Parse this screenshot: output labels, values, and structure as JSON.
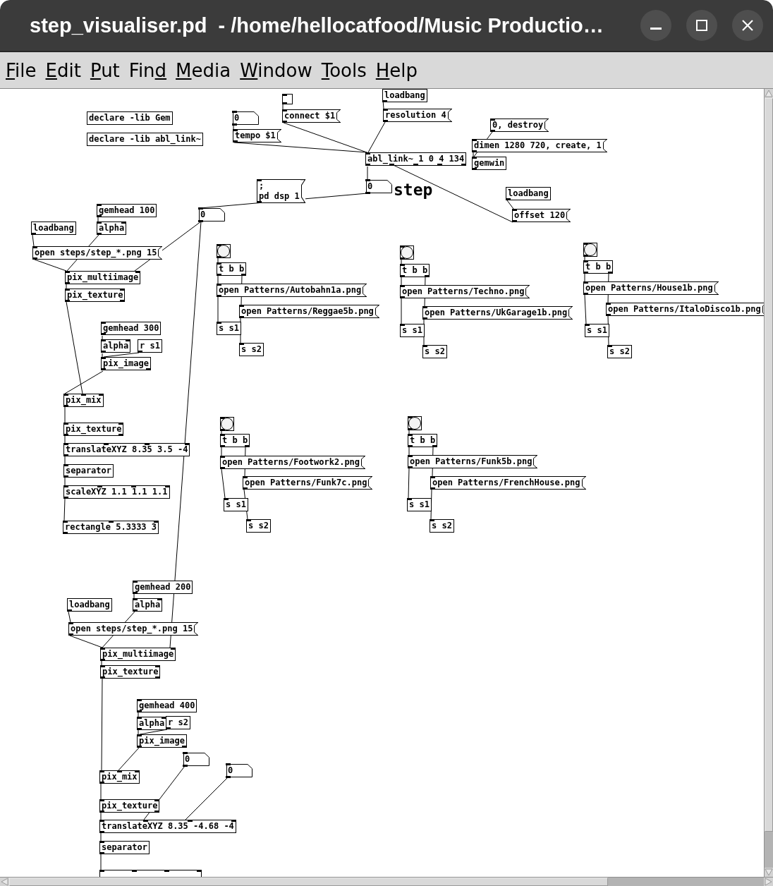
{
  "window": {
    "title": "step_visualiser.pd  - /home/hellocatfood/Music Productio…"
  },
  "menu": [
    {
      "parts": [
        {
          "text": "F",
          "underlined": true
        },
        {
          "text": "ile",
          "underlined": false
        }
      ]
    },
    {
      "parts": [
        {
          "text": "E",
          "underlined": true
        },
        {
          "text": "dit",
          "underlined": false
        }
      ]
    },
    {
      "parts": [
        {
          "text": "P",
          "underlined": true
        },
        {
          "text": "ut",
          "underlined": false
        }
      ]
    },
    {
      "parts": [
        {
          "text": "Fin",
          "underlined": false
        },
        {
          "text": "d",
          "underlined": true
        }
      ]
    },
    {
      "parts": [
        {
          "text": "M",
          "underlined": true
        },
        {
          "text": "edia",
          "underlined": false
        }
      ]
    },
    {
      "parts": [
        {
          "text": "W",
          "underlined": true
        },
        {
          "text": "indow",
          "underlined": false
        }
      ]
    },
    {
      "parts": [
        {
          "text": "T",
          "underlined": true
        },
        {
          "text": "ools",
          "underlined": false
        }
      ]
    },
    {
      "parts": [
        {
          "text": "H",
          "underlined": true
        },
        {
          "text": "elp",
          "underlined": false
        }
      ]
    }
  ],
  "canvas": {
    "items": [
      {
        "kind": "object",
        "text": "declare -lib Gem"
      },
      {
        "kind": "object",
        "text": "declare -lib abl_link~"
      },
      {
        "kind": "toggle",
        "checked": false
      },
      {
        "kind": "number",
        "text": "0"
      },
      {
        "kind": "message",
        "text": "connect $1"
      },
      {
        "kind": "message",
        "text": "tempo $1"
      },
      {
        "kind": "object",
        "text": "loadbang"
      },
      {
        "kind": "message",
        "text": "resolution 4"
      },
      {
        "kind": "message",
        "text": "0, destroy"
      },
      {
        "kind": "message",
        "text": "dimen 1280 720, create, 1"
      },
      {
        "kind": "object",
        "text": "abl_link~ 1 0 4 134"
      },
      {
        "kind": "object",
        "text": "gemwin"
      },
      {
        "kind": "message",
        "text": ";\npd dsp 1"
      },
      {
        "kind": "number",
        "text": "0"
      },
      {
        "kind": "comment",
        "text": "step"
      },
      {
        "kind": "object",
        "text": "loadbang"
      },
      {
        "kind": "object",
        "text": "gemhead 100"
      },
      {
        "kind": "number",
        "text": "0"
      },
      {
        "kind": "message",
        "text": "offset 120"
      },
      {
        "kind": "object",
        "text": "loadbang"
      },
      {
        "kind": "object",
        "text": "alpha"
      },
      {
        "kind": "message",
        "text": "open steps/step_*.png 15"
      },
      {
        "kind": "object",
        "text": "pix_multiimage"
      },
      {
        "kind": "object",
        "text": "pix_texture"
      },
      {
        "kind": "object",
        "text": "gemhead 300"
      },
      {
        "kind": "object",
        "text": "alpha"
      },
      {
        "kind": "object",
        "text": "r s1"
      },
      {
        "kind": "object",
        "text": "pix_image"
      },
      {
        "kind": "object",
        "text": "pix_mix"
      },
      {
        "kind": "object",
        "text": "pix_texture"
      },
      {
        "kind": "object",
        "text": "translateXYZ 8.35 3.5 -4"
      },
      {
        "kind": "object",
        "text": "separator"
      },
      {
        "kind": "object",
        "text": "scaleXYZ 1.1 1.1 1.1"
      },
      {
        "kind": "object",
        "text": "rectangle 5.3333 3"
      },
      {
        "kind": "bang"
      },
      {
        "kind": "object",
        "text": "t b b"
      },
      {
        "kind": "message",
        "text": "open Patterns/Autobahn1a.png"
      },
      {
        "kind": "message",
        "text": "open Patterns/Reggae5b.png"
      },
      {
        "kind": "object",
        "text": "s s1"
      },
      {
        "kind": "object",
        "text": "s s2"
      },
      {
        "kind": "bang"
      },
      {
        "kind": "object",
        "text": "t b b"
      },
      {
        "kind": "message",
        "text": "open Patterns/Techno.png"
      },
      {
        "kind": "message",
        "text": "open Patterns/UkGarage1b.png"
      },
      {
        "kind": "object",
        "text": "s s1"
      },
      {
        "kind": "object",
        "text": "s s2"
      },
      {
        "kind": "bang"
      },
      {
        "kind": "object",
        "text": "t b b"
      },
      {
        "kind": "message",
        "text": "open Patterns/House1b.png"
      },
      {
        "kind": "message",
        "text": "open Patterns/ItaloDisco1b.png"
      },
      {
        "kind": "object",
        "text": "s s1"
      },
      {
        "kind": "object",
        "text": "s s2"
      },
      {
        "kind": "bang"
      },
      {
        "kind": "object",
        "text": "t b b"
      },
      {
        "kind": "message",
        "text": "open Patterns/Footwork2.png"
      },
      {
        "kind": "message",
        "text": "open Patterns/Funk7c.png"
      },
      {
        "kind": "object",
        "text": "s s1"
      },
      {
        "kind": "object",
        "text": "s s2"
      },
      {
        "kind": "bang"
      },
      {
        "kind": "object",
        "text": "t b b"
      },
      {
        "kind": "message",
        "text": "open Patterns/Funk5b.png"
      },
      {
        "kind": "message",
        "text": "open Patterns/FrenchHouse.png"
      },
      {
        "kind": "object",
        "text": "s s1"
      },
      {
        "kind": "object",
        "text": "s s2"
      },
      {
        "kind": "object",
        "text": "gemhead 200"
      },
      {
        "kind": "object",
        "text": "loadbang"
      },
      {
        "kind": "object",
        "text": "alpha"
      },
      {
        "kind": "message",
        "text": "open steps/step_*.png 15"
      },
      {
        "kind": "object",
        "text": "pix_multiimage"
      },
      {
        "kind": "object",
        "text": "pix_texture"
      },
      {
        "kind": "object",
        "text": "gemhead 400"
      },
      {
        "kind": "object",
        "text": "alpha"
      },
      {
        "kind": "object",
        "text": "r s2"
      },
      {
        "kind": "object",
        "text": "pix_image"
      },
      {
        "kind": "number",
        "text": "0"
      },
      {
        "kind": "object",
        "text": "pix_mix"
      },
      {
        "kind": "number",
        "text": "0"
      },
      {
        "kind": "object",
        "text": "pix_texture"
      },
      {
        "kind": "object",
        "text": "translateXYZ 8.35 -4.68 -4"
      },
      {
        "kind": "object",
        "text": "separator"
      },
      {
        "kind": "object"
      }
    ]
  }
}
